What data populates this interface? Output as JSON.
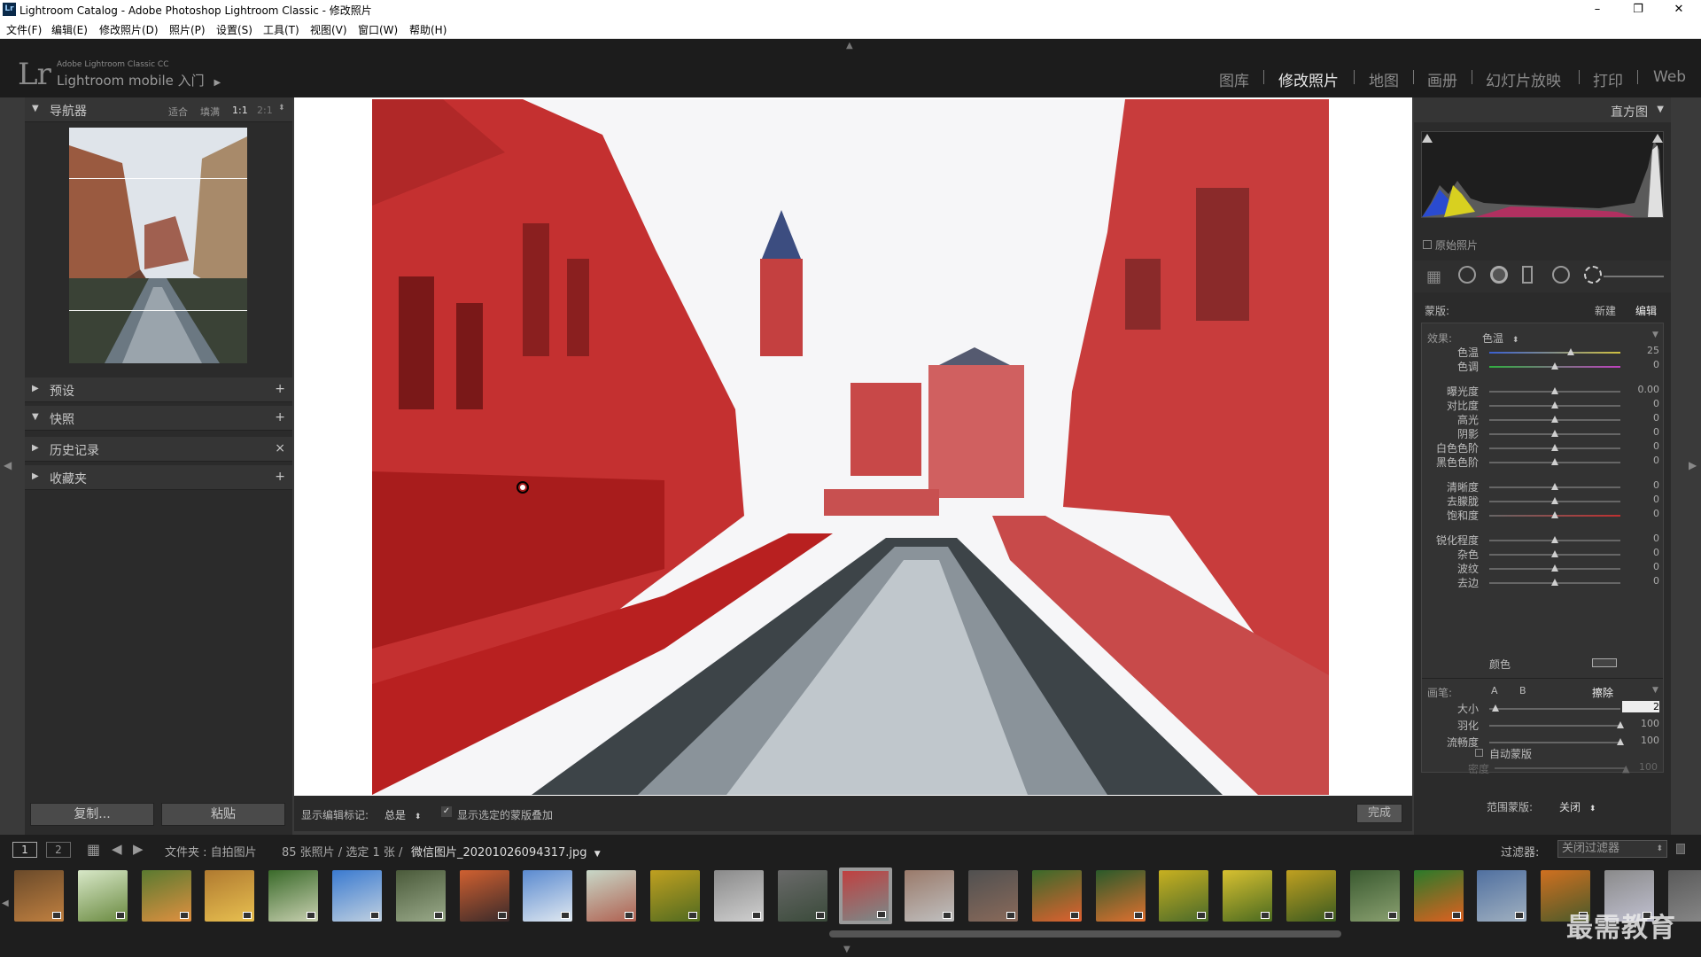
{
  "window": {
    "title": "Lightroom Catalog - Adobe Photoshop Lightroom Classic - 修改照片",
    "app_icon": "Lr",
    "controls": [
      "–",
      "❐",
      "✕"
    ]
  },
  "menu": [
    "文件(F)",
    "编辑(E)",
    "修改照片(D)",
    "照片(P)",
    "设置(S)",
    "工具(T)",
    "视图(V)",
    "窗口(W)",
    "帮助(H)"
  ],
  "identity": {
    "logo": "Lr",
    "product": "Adobe Lightroom Classic CC",
    "mobile": "Lightroom mobile 入门"
  },
  "modules": [
    "图库",
    "修改照片",
    "地图",
    "画册",
    "幻灯片放映",
    "打印",
    "Web"
  ],
  "active_module_index": 1,
  "left_panel": {
    "navigator": {
      "title": "导航器",
      "zoom_options": [
        "适合",
        "填满",
        "1:1",
        "2:1"
      ]
    },
    "sections": [
      {
        "label": "预设",
        "action": "+"
      },
      {
        "label": "快照",
        "action": "+"
      },
      {
        "label": "历史记录",
        "action": "×"
      },
      {
        "label": "收藏夹",
        "action": "+"
      }
    ],
    "copy_button": "复制...",
    "paste_button": "粘贴"
  },
  "toolbar": {
    "show_edit_pins_label": "显示编辑标记:",
    "show_edit_pins_value": "总是",
    "show_overlay_label": "显示选定的蒙版叠加",
    "done_button": "完成"
  },
  "right_panel": {
    "histogram_title": "直方图",
    "original_photo_label": "原始照片",
    "mask_label": "蒙版:",
    "mask_new": "新建",
    "mask_edit": "编辑",
    "effect_label": "效果:",
    "effect_value": "色温",
    "groups": [
      [
        {
          "label": "色温",
          "value": "25",
          "pos": 0.62
        },
        {
          "label": "色调",
          "value": "0",
          "pos": 0.5
        }
      ],
      [
        {
          "label": "曝光度",
          "value": "0.00",
          "pos": 0.5
        },
        {
          "label": "对比度",
          "value": "0",
          "pos": 0.5
        },
        {
          "label": "高光",
          "value": "0",
          "pos": 0.5
        },
        {
          "label": "阴影",
          "value": "0",
          "pos": 0.5
        },
        {
          "label": "白色色阶",
          "value": "0",
          "pos": 0.5
        },
        {
          "label": "黑色色阶",
          "value": "0",
          "pos": 0.5
        }
      ],
      [
        {
          "label": "清晰度",
          "value": "0",
          "pos": 0.5
        },
        {
          "label": "去朦胧",
          "value": "0",
          "pos": 0.5
        },
        {
          "label": "饱和度",
          "value": "0",
          "pos": 0.5
        }
      ],
      [
        {
          "label": "锐化程度",
          "value": "0",
          "pos": 0.5
        },
        {
          "label": "杂色",
          "value": "0",
          "pos": 0.5
        },
        {
          "label": "波纹",
          "value": "0",
          "pos": 0.5
        },
        {
          "label": "去边",
          "value": "0",
          "pos": 0.5
        }
      ]
    ],
    "color_label": "颜色",
    "brush_label": "画笔:",
    "brush_a": "A",
    "brush_b": "B",
    "brush_erase": "擦除",
    "brush_rows": [
      {
        "label": "大小",
        "value": "2",
        "pos": 0.05
      },
      {
        "label": "羽化",
        "value": "100",
        "pos": 1.0
      },
      {
        "label": "流畅度",
        "value": "100",
        "pos": 1.0
      }
    ],
    "auto_mask": "自动蒙版",
    "density_label": "密度",
    "density_value": "100",
    "range_mask_label": "范围蒙版:",
    "range_mask_value": "关闭"
  },
  "filmstrip": {
    "page_1": "1",
    "page_2": "2",
    "path_prefix": "文件夹 : 自拍图片",
    "count": "85 张照片 / 选定 1 张 /",
    "filename": "微信图片_20201026094317.jpg",
    "filter_label": "过滤器:",
    "filter_value": "关闭过滤器",
    "selected_index": 13
  },
  "watermark": "最需教育",
  "colors": {
    "accent_mask": "#d02020",
    "panel": "#2b2b2b",
    "topbar": "#1c1c1c"
  }
}
